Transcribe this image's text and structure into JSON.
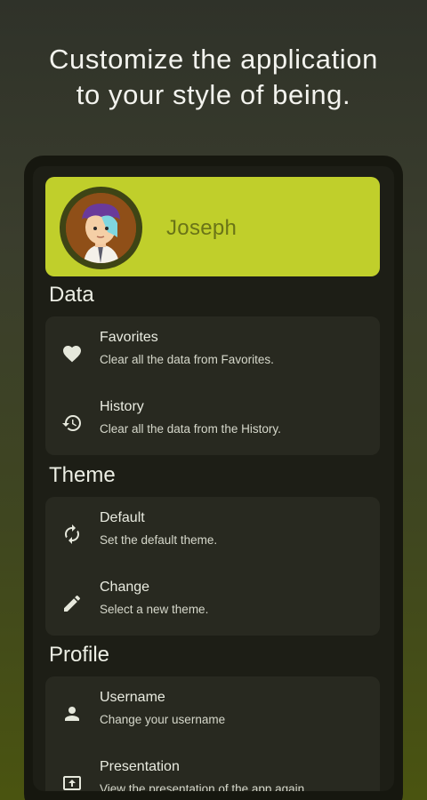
{
  "headline": {
    "line1": "Customize the application",
    "line2": "to your style of being."
  },
  "profile": {
    "name": "Joseph"
  },
  "sections": {
    "data": {
      "title": "Data",
      "items": [
        {
          "title": "Favorites",
          "subtitle": "Clear all the data from Favorites.",
          "icon": "heart-icon"
        },
        {
          "title": "History",
          "subtitle": "Clear all the data from the History.",
          "icon": "history-icon"
        }
      ]
    },
    "theme": {
      "title": "Theme",
      "items": [
        {
          "title": "Default",
          "subtitle": "Set the default theme.",
          "icon": "reset-icon"
        },
        {
          "title": "Change",
          "subtitle": "Select a new theme.",
          "icon": "pencil-icon"
        }
      ]
    },
    "profile": {
      "title": "Profile",
      "items": [
        {
          "title": "Username",
          "subtitle": "Change your username",
          "icon": "person-icon"
        },
        {
          "title": "Presentation",
          "subtitle": "View the presentation of the app again",
          "icon": "presentation-icon"
        }
      ]
    }
  },
  "colors": {
    "accent": "#c0cf2b",
    "card": "#282920",
    "screen": "#1d1e16"
  }
}
